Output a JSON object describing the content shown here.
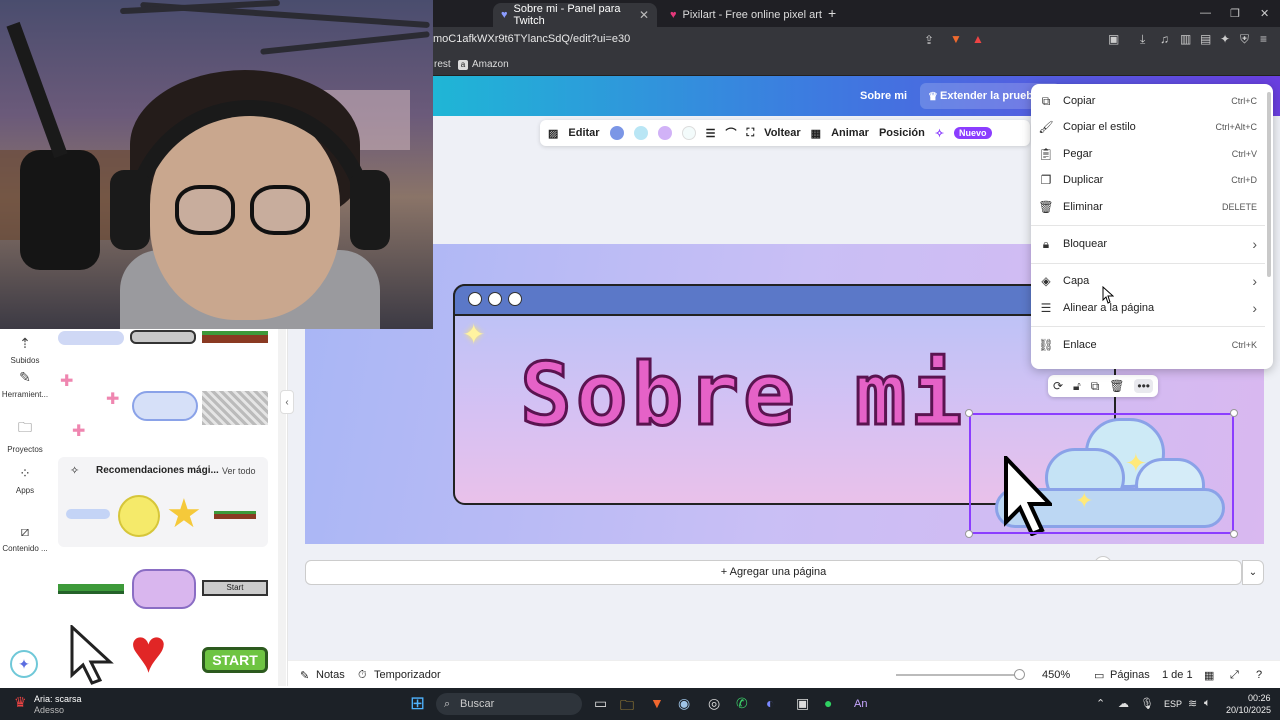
{
  "browser": {
    "tabs": [
      {
        "label": "Sobre mi - Panel para Twitch",
        "active": true
      },
      {
        "label": "Pixilart - Free online pixel art drawing",
        "active": false
      }
    ],
    "url": "moC1afkWXr9t6TYlancSdQ/edit?ui=e30",
    "bookmarks": [
      "rest",
      "Amazon"
    ]
  },
  "canva_header": {
    "about": "Sobre mi",
    "extend_trial": "Extender la prueba"
  },
  "toolbar": {
    "edit": "Editar",
    "flip": "Voltear",
    "animate": "Animar",
    "position": "Posición",
    "new_badge": "Nuevo",
    "colors": [
      "#7b96e6",
      "#b9e6f5",
      "#d1b2f7",
      "#f3fbfb"
    ]
  },
  "left_nav": [
    {
      "label": "Subidos",
      "icon": "upload-icon"
    },
    {
      "label": "Herramient...",
      "icon": "pencil-icon"
    },
    {
      "label": "Proyectos",
      "icon": "folder-icon"
    },
    {
      "label": "Apps",
      "icon": "apps-icon"
    },
    {
      "label": "Contenido ...",
      "icon": "content-icon"
    }
  ],
  "panel": {
    "recommendations_title": "Recomendaciones mági...",
    "see_all": "Ver todo",
    "start_small": "Start",
    "start_big": "START"
  },
  "canvas": {
    "title": "Sobre mi"
  },
  "context_menu": [
    {
      "label": "Copiar",
      "shortcut": "Ctrl+C",
      "icon": "copy-icon"
    },
    {
      "label": "Copiar el estilo",
      "shortcut": "Ctrl+Alt+C",
      "icon": "paint-roller-icon"
    },
    {
      "label": "Pegar",
      "shortcut": "Ctrl+V",
      "icon": "paste-icon"
    },
    {
      "label": "Duplicar",
      "shortcut": "Ctrl+D",
      "icon": "duplicate-icon"
    },
    {
      "label": "Eliminar",
      "shortcut": "DELETE",
      "icon": "trash-icon"
    },
    {
      "label": "Bloquear",
      "shortcut": "›",
      "icon": "lock-icon"
    },
    {
      "label": "Capa",
      "shortcut": "›",
      "icon": "layers-icon"
    },
    {
      "label": "Alinear a la página",
      "shortcut": "›",
      "icon": "align-icon"
    },
    {
      "label": "Enlace",
      "shortcut": "Ctrl+K",
      "icon": "link-icon"
    }
  ],
  "add_page": "+ Agregar una página",
  "footer": {
    "notes": "Notas",
    "timer": "Temporizador",
    "zoom": "450%",
    "pages": "Páginas",
    "page_count": "1 de 1"
  },
  "taskbar": {
    "notification_title": "Aria: scarsa",
    "notification_sub": "Adesso",
    "search": "Buscar",
    "lang": "ESP",
    "time": "00:26",
    "date": "20/10/2025"
  }
}
